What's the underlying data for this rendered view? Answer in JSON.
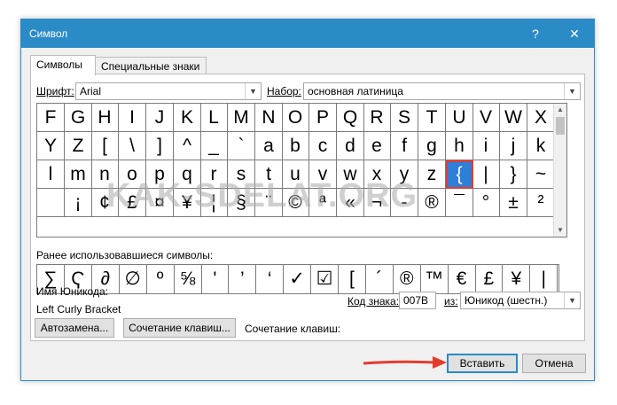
{
  "window": {
    "title": "Символ",
    "help_label": "?",
    "close_label": "✕"
  },
  "tabs": [
    {
      "label": "Символы",
      "active": true
    },
    {
      "label": "Специальные знаки",
      "active": false
    }
  ],
  "font": {
    "label": "Шрифт:",
    "value": "Arial"
  },
  "subset": {
    "label": "Набор:",
    "value": "основная латиница"
  },
  "grid": {
    "rows": [
      [
        "F",
        "G",
        "H",
        "I",
        "J",
        "K",
        "L",
        "M",
        "N",
        "O",
        "P",
        "Q",
        "R",
        "S",
        "T",
        "U",
        "V",
        "W",
        "X"
      ],
      [
        "Y",
        "Z",
        "[",
        "\\",
        "]",
        "^",
        "_",
        "`",
        "a",
        "b",
        "c",
        "d",
        "e",
        "f",
        "g",
        "h",
        "i",
        "j",
        "k"
      ],
      [
        "l",
        "m",
        "n",
        "o",
        "p",
        "q",
        "r",
        "s",
        "t",
        "u",
        "v",
        "w",
        "x",
        "y",
        "z",
        "{",
        "|",
        "}",
        "~"
      ],
      [
        "",
        "¡",
        "¢",
        "£",
        "¤",
        "¥",
        "¦",
        "§",
        "¨",
        "©",
        "ª",
        "«",
        "¬",
        "-",
        "®",
        "¯",
        "°",
        "±",
        "²"
      ]
    ],
    "selected": {
      "row": 2,
      "col": 15
    }
  },
  "recent": {
    "label": "Ранее использовавшиеся символы:",
    "symbols": [
      "∑",
      "Ҁ",
      "∂",
      "∅",
      "º",
      "⅝",
      "'",
      "’",
      "‘",
      "✓",
      "☑",
      "[",
      "´",
      "®",
      "™",
      "€",
      "£",
      "¥",
      "|"
    ]
  },
  "unicode_name": {
    "label": "Имя Юникода:",
    "value": "Left Curly Bracket"
  },
  "char_code": {
    "label": "Код знака:",
    "value": "007B"
  },
  "from": {
    "label": "из:",
    "value": "Юникод (шестн.)"
  },
  "buttons": {
    "autocorrect": "Автозамена...",
    "shortcut_key": "Сочетание клавиш...",
    "insert": "Вставить",
    "cancel": "Отмена"
  },
  "shortcut_label": "Сочетание клавиш:",
  "watermark": "KAK-SDELAT.ORG",
  "colors": {
    "accent": "#2b8bc7",
    "selection": "#2f7ed8",
    "highlight_border": "#e23b2e",
    "arrow": "#e23b2e"
  }
}
